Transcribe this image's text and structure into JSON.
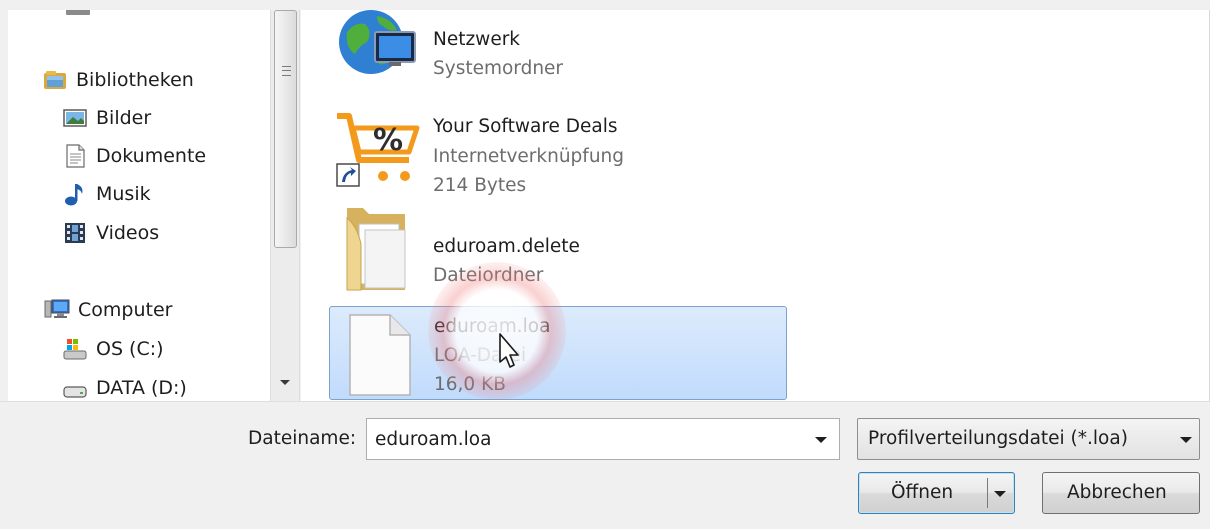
{
  "nav": {
    "libraries_label": "Bibliotheken",
    "pictures_label": "Bilder",
    "documents_label": "Dokumente",
    "music_label": "Musik",
    "videos_label": "Videos",
    "computer_label": "Computer",
    "drive_c_label": "OS (C:)",
    "drive_d_label": "DATA (D:)"
  },
  "files": [
    {
      "name": "Netzwerk",
      "type": "Systemordner",
      "icon": "network-globe-icon"
    },
    {
      "name": "Your Software Deals",
      "type": "Internetverknüpfung",
      "size": "214 Bytes",
      "icon": "shopping-cart-percent-icon"
    },
    {
      "name": "eduroam.delete",
      "type": "Dateiordner",
      "icon": "folder-icon"
    },
    {
      "name": "eduroam.loa",
      "type": "LOA-Datei",
      "size": "16,0 KB",
      "icon": "blank-file-icon",
      "selected": true
    }
  ],
  "footer": {
    "filename_label": "Dateiname:",
    "filename_value": "eduroam.loa",
    "filetype_value": "Profilverteilungsdatei (*.loa)",
    "open_label": "Öffnen",
    "cancel_label": "Abbrechen"
  },
  "colors": {
    "selection": "#c1dbfc",
    "selection_border": "#7da2ce",
    "cart_orange": "#f39a1c"
  }
}
